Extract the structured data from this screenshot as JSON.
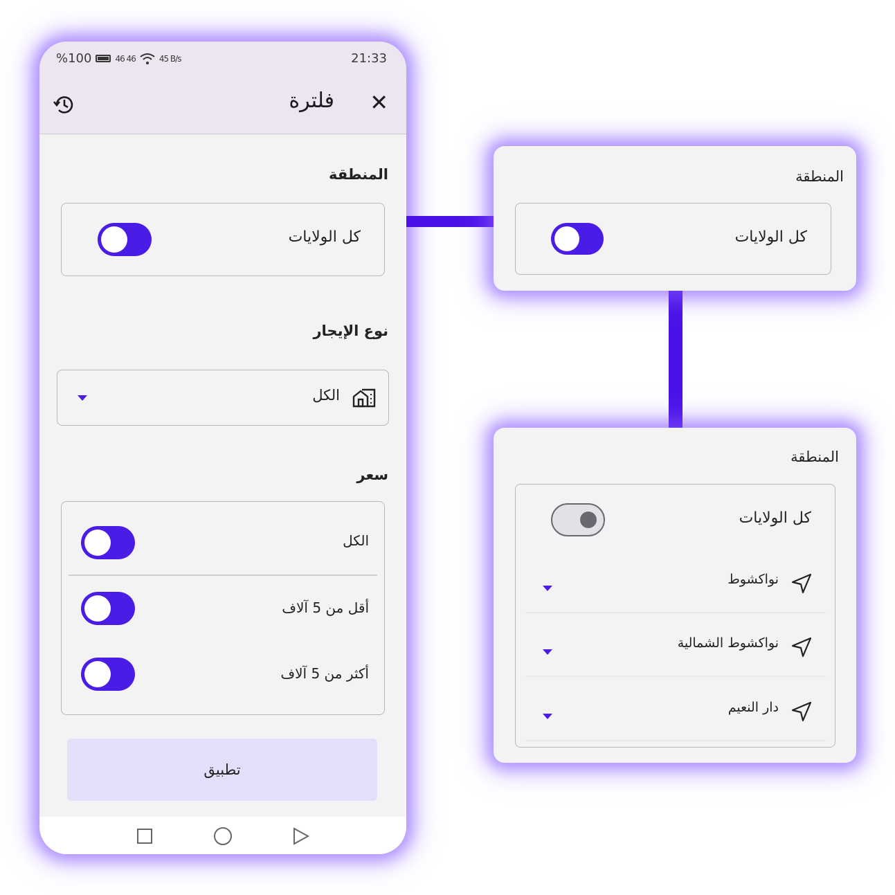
{
  "status_bar": {
    "battery": "%100",
    "network": "46 46",
    "speed": "45 B/s",
    "time": "21:33"
  },
  "app_bar": {
    "title": "فلترة",
    "close_icon": "close-icon",
    "history_icon": "history-icon"
  },
  "sections": {
    "region": {
      "label": "المنطقة",
      "all_states": "كل الولايات",
      "toggle_on": true
    },
    "rent_type": {
      "label": "نوع الإيجار",
      "selected": "الكل",
      "icon": "building-icon"
    },
    "price": {
      "label": "سعر",
      "options": [
        {
          "label": "الكل",
          "on": true
        },
        {
          "label": "أقل من 5 آلاف",
          "on": true
        },
        {
          "label": "أكثر من 5 آلاف",
          "on": true
        }
      ]
    }
  },
  "apply_button": "تطبيق",
  "zoom_panel_top": {
    "label": "المنطقة",
    "all_states": "كل الولايات",
    "toggle_on": true
  },
  "zoom_panel_bottom": {
    "label": "المنطقة",
    "all_states": "كل الولايات",
    "toggle_on": false,
    "locations": [
      "نواكشوط",
      "نواكشوط الشمالية",
      "دار النعيم"
    ]
  },
  "colors": {
    "accent": "#4a1ce6",
    "app_bar": "#ece6f1",
    "apply_button": "#e5defb",
    "background": "#f4f3f4"
  }
}
